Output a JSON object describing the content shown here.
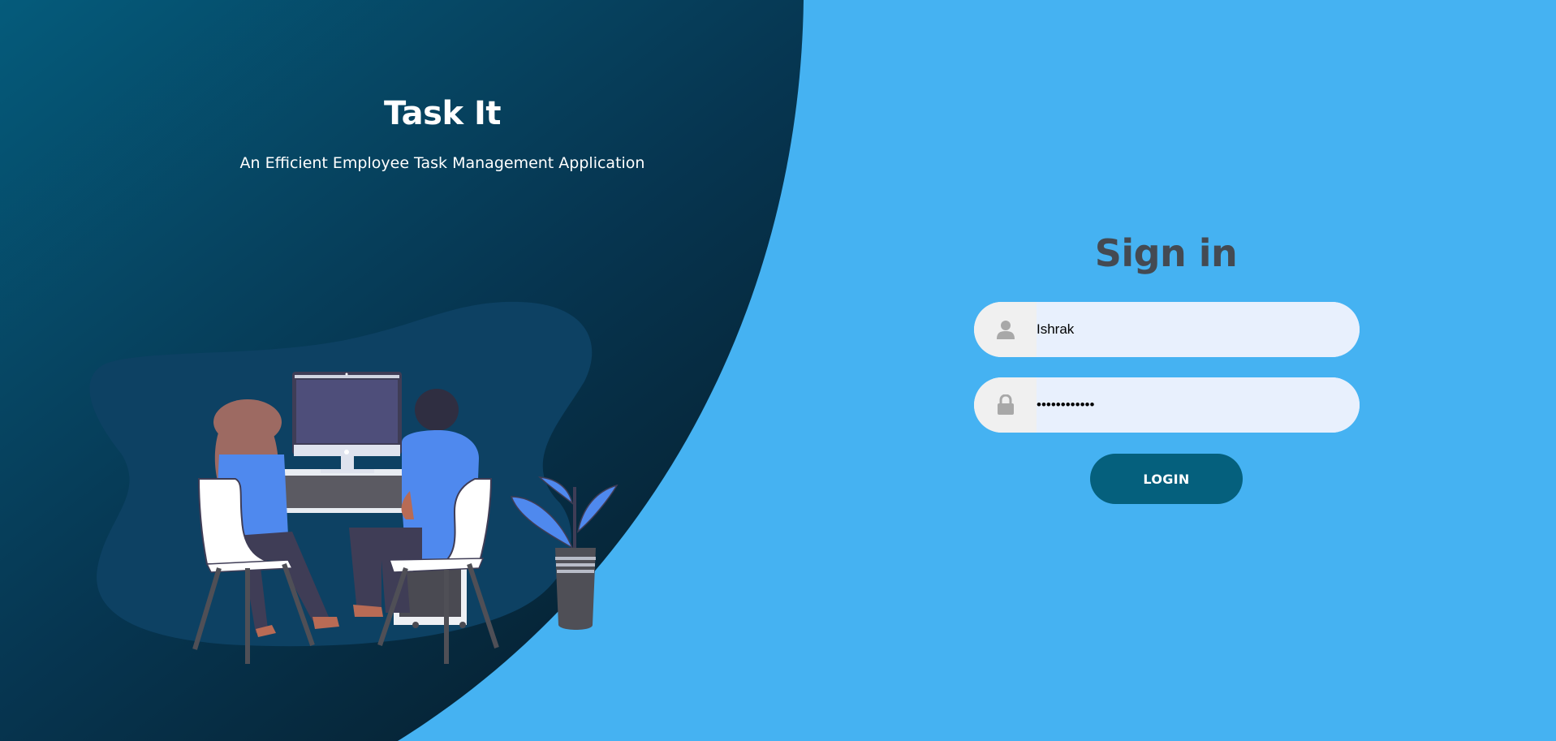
{
  "hero": {
    "title": "Task It",
    "subtitle": "An Efficient Employee Task Management Application"
  },
  "signin": {
    "title": "Sign in",
    "username": {
      "value": "Ishrak",
      "icon": "user-icon"
    },
    "password": {
      "value": "••••••••••••",
      "icon": "lock-icon"
    },
    "login_label": "LOGIN"
  },
  "colors": {
    "background": "#45b2f2",
    "panel_dark": "#06263a",
    "panel_teal": "#055b7b",
    "button": "#05607d",
    "input_bg": "#e8f0fd",
    "heading": "#444a52"
  }
}
